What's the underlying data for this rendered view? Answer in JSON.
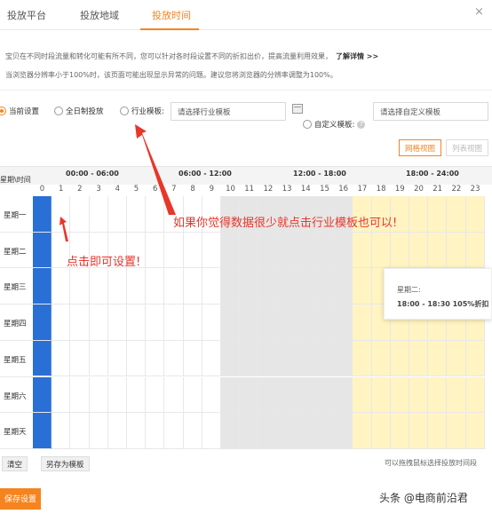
{
  "tabs": [
    {
      "label": "投放平台"
    },
    {
      "label": "投放地域"
    },
    {
      "label": "投放时间",
      "active": true
    }
  ],
  "close_icon": "×",
  "info": {
    "line1": "宝贝在不同时段流量和转化可能有所不同，您可以针对各时段设置不同的折扣出价，提高流量利用效果，",
    "link": "了解详情 >>",
    "line2": "当浏览器分辨率小于100%时，该页面可能出现显示异常的问题。建议您将浏览器的分辨率调整为100%。"
  },
  "options": {
    "current": "当前设置",
    "all_day": "全日制投放",
    "industry": "行业模板:",
    "industry_placeholder": "请选择行业模板",
    "custom": "自定义模板:",
    "custom_placeholder": "请选择自定义模板"
  },
  "views": {
    "grid": "网格视图",
    "list": "列表视图"
  },
  "grid": {
    "corner": "星期\\时间",
    "ranges": [
      "00:00 - 06:00",
      "06:00 - 12:00",
      "12:00 - 18:00",
      "18:00 - 24:00"
    ],
    "hours": [
      "0",
      "1",
      "2",
      "3",
      "4",
      "5",
      "6",
      "7",
      "8",
      "9",
      "10",
      "11",
      "12",
      "13",
      "14",
      "15",
      "16",
      "17",
      "18",
      "19",
      "20",
      "21",
      "22",
      "23"
    ],
    "days": [
      "星期一",
      "星期二",
      "星期三",
      "星期四",
      "星期五",
      "星期六",
      "星期天"
    ]
  },
  "tooltip": {
    "day": "星期二:",
    "detail": "18:00 - 18:30  105%折扣"
  },
  "annotations": {
    "top": "如果你觉得数据很少就点击行业模板也可以!",
    "left": "点击即可设置!"
  },
  "buttons": {
    "clear": "清空",
    "save_template": "另存为模板",
    "save": "保存设置"
  },
  "hint": "可以拖拽鼠标选择投放时间段",
  "watermark": "头条 @电商前沿君",
  "colors": {
    "accent": "#f5841f",
    "selected": "#2a6fd6",
    "annotation": "#e8362a",
    "highlight": "#fff4c2"
  }
}
